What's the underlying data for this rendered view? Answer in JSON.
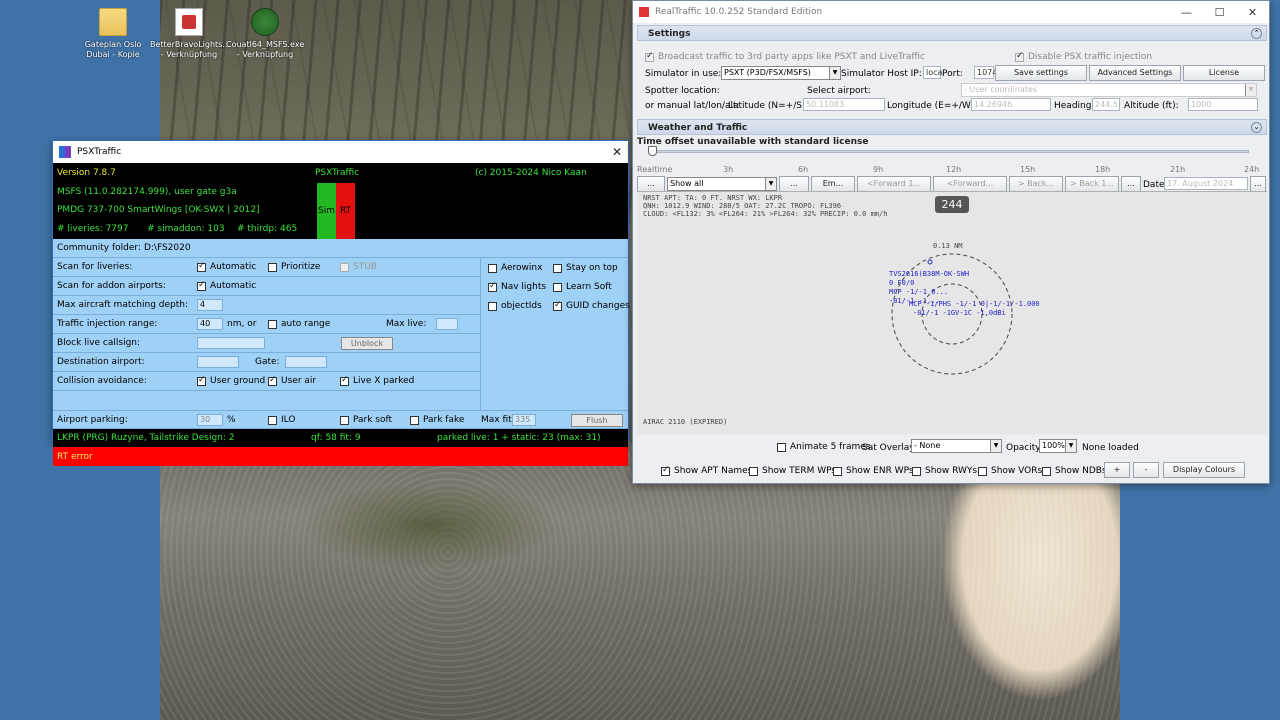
{
  "desktop": {
    "icons": [
      {
        "label": "Gateplan Oslo Dubai - Kopie",
        "icon": "folder-icon"
      },
      {
        "label": "BetterBravoLights... - Verknüpfung",
        "icon": "shortcut-icon"
      },
      {
        "label": "Couatl64_MSFS.exe - Verknüpfung",
        "icon": "app-icon"
      }
    ]
  },
  "psx": {
    "title": "PSXTraffic",
    "version": "Version 7.8.7",
    "app_name": "PSXTraffic",
    "copyright": "(c) 2015-2024 Nico Kaan",
    "sim_line": "MSFS (11.0.282174.999), user gate g3a",
    "aircraft_line": "PMDG 737-700 SmartWings [OK-SWX | 2012]",
    "liveries": "# liveries: 7797",
    "simaddon": "# simaddon: 103",
    "thirdp": "# thirdp: 465",
    "sim_badge": "Sim",
    "rt_badge": "RT",
    "community_label": "Community folder:",
    "community_value": "D:\\FS2020",
    "scan_liveries_label": "Scan for liveries:",
    "automatic": "Automatic",
    "prioritize": "Prioritize",
    "stub": "STUB",
    "scan_addon_label": "Scan for addon airports:",
    "max_depth_label": "Max aircraft matching depth:",
    "max_depth_value": "4",
    "injection_label": "Traffic injection range:",
    "injection_value": "40",
    "nm_or": "nm,   or",
    "auto_range": "auto range",
    "max_live_label": "Max live:",
    "block_label": "Block live callsign:",
    "unblock": "Unblock",
    "dest_label": "Destination airport:",
    "gate_label": "Gate:",
    "collision_label": "Collision avoidance:",
    "user_ground": "User ground",
    "user_air": "User air",
    "live_x_parked": "Live X parked",
    "parking_label": "Airport parking:",
    "parking_value": "30",
    "percent": "%",
    "ilo": "ILO",
    "park_soft": "Park soft",
    "park_fake": "Park fake",
    "max_fit_label": "Max fit:",
    "max_fit_value": "335",
    "flush": "Flush",
    "right_opts": {
      "aerowinx": "Aerowinx",
      "stay_on_top": "Stay on top",
      "nav_lights": "Nav lights",
      "learn_soft": "Learn Soft",
      "objectids": "objectIds",
      "guid_changes": "GUID changes"
    },
    "status_left": "LKPR (PRG)  Ruzyne, Tailstrike Design: 2",
    "status_mid": "qf: 58  fit:  9",
    "status_right": "parked live:    1 + static:   23 (max:  31)",
    "error": "RT error"
  },
  "rt": {
    "title": "RealTraffic 10.0.252 Standard Edition",
    "settings_head": "Settings",
    "broadcast": "Broadcast traffic to 3rd party apps like PSXT and LiveTraffic",
    "disable_psx": "Disable PSX traffic injection",
    "sim_in_use_label": "Simulator in use:",
    "sim_in_use_value": "PSXT (P3D/FSX/MSFS)",
    "host_ip_label": "Simulator Host IP:",
    "host_ip_value": "loca",
    "port_label": "Port:",
    "port_value": "1074",
    "save_settings": "Save settings",
    "advanced_settings": "Advanced Settings",
    "license": "License",
    "spotter_label": "Spotter location:",
    "select_airport_label": "Select airport:",
    "user_coordinates": "- User coordinates",
    "manual_label": "or manual lat/lon/alt:",
    "latitude_label": "Latitude (N=+/S=-):",
    "latitude_value": "50.11083",
    "longitude_label": "Longitude (E=+/W=-):",
    "longitude_value": "14.26946",
    "heading_label": "Heading:",
    "heading_value": "244.5",
    "altitude_label": "Altitude (ft):",
    "altitude_value": "1000",
    "weather_head": "Weather and Traffic",
    "time_offset": "Time offset unavailable with standard license",
    "timeline": [
      "Realtime",
      "3h",
      "6h",
      "9h",
      "12h",
      "15h",
      "18h",
      "21h",
      "24h"
    ],
    "dots": "...",
    "show_all": "Show all",
    "em": "Em...",
    "forward1": "<Forward 1...",
    "forward2": "<Forward...",
    "back1": "> Back...",
    "back2": "> Back 1...",
    "date_label": "Date:",
    "date_value": "17. August 2024",
    "heading_badge": "244",
    "wx1": "NRST APT:  TA: 0 FT. NRST WX: LKPR",
    "wx2": "QNH: 1012.9 WIND: 288/5 OAT: 27.2C TROPO: FL396",
    "wx3": "CLOUD: <FL132: 3% <FL264: 21% >FL264: 32% PRECIP: 0.0 mm/h",
    "range_label": "0.13 NM",
    "traffic1": "TVS2616(B38M-OK-SWH",
    "traffic2": "0 F0/0",
    "traffic3": "MCP -1/-1 0...",
    "traffic4": "-01/-1 -1...",
    "traffic5": "MCP -1/PHS -1/-1 0|-1/-1/-1.000",
    "traffic6": "-01/-1 -1GV-1C -1,0dBi",
    "airac": "AIRAC 2110 (EXPIRED)",
    "animate": "Animate 5 frames",
    "sat_overlay_label": "Sat Overlay:",
    "sat_overlay_value": "- None",
    "opacity_label": "Opacity:",
    "opacity_value": "100%",
    "none_loaded": "None loaded",
    "show_apt": "Show APT Names",
    "show_term": "Show TERM WPs",
    "show_enr": "Show ENR WPs",
    "show_rwys": "Show RWYs",
    "show_vors": "Show VORs",
    "show_ndbs": "Show NDBs",
    "plus": "+",
    "minus": "-",
    "display_colours": "Display Colours"
  }
}
